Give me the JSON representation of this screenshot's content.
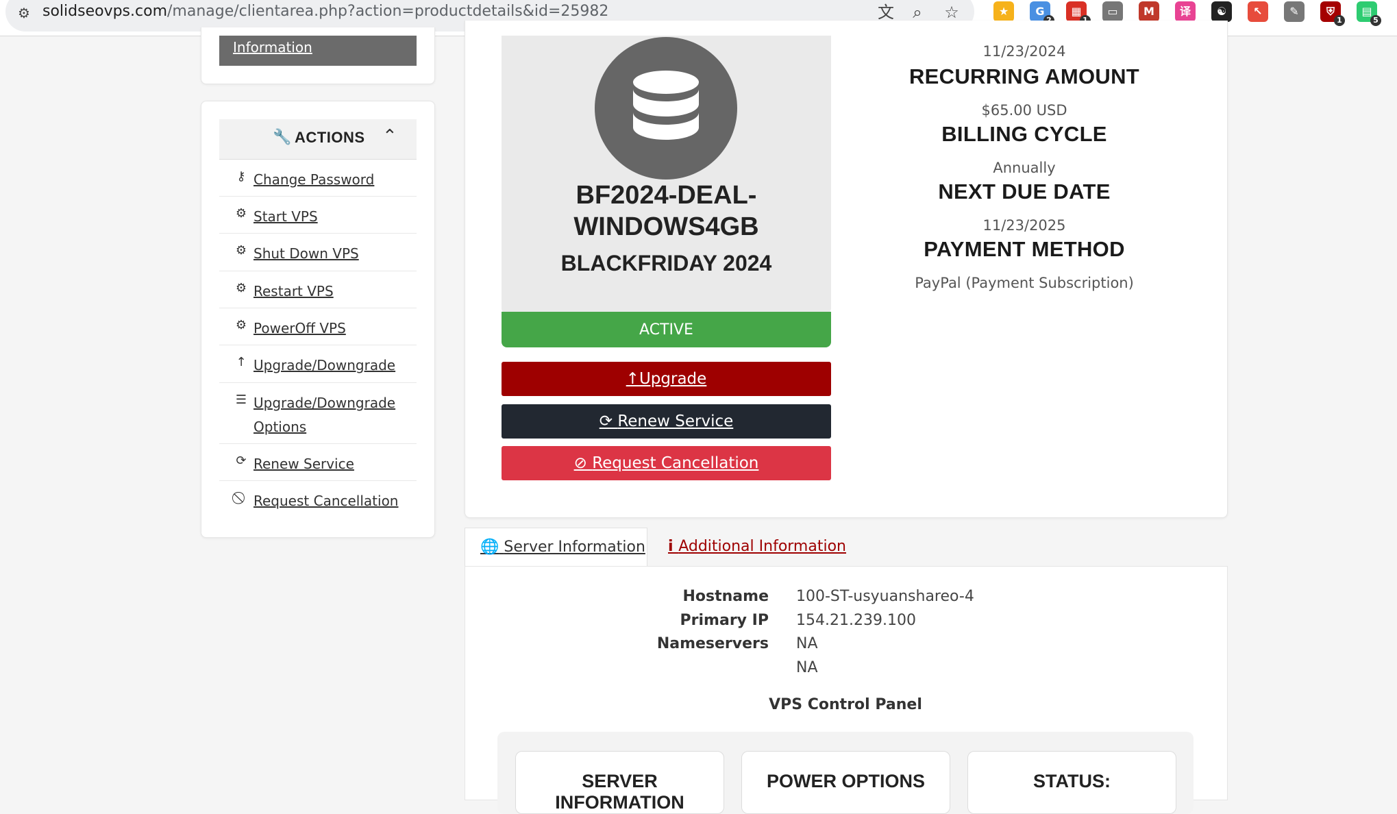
{
  "browser": {
    "url_domain": "solidseovps.com",
    "url_path": "/manage/clientarea.php?action=productdetails&id=25982",
    "extensions": [
      {
        "icon": "star-extension-icon",
        "color": "#f6b21b",
        "badge": ""
      },
      {
        "icon": "grammar-extension-icon",
        "color": "#4a90e2",
        "badge": "2"
      },
      {
        "icon": "calendar-extension-icon",
        "color": "#d93025",
        "badge": "1"
      },
      {
        "icon": "tab-extension-icon",
        "color": "#777777",
        "badge": ""
      },
      {
        "icon": "m-extension-icon",
        "color": "#c0392b",
        "badge": ""
      },
      {
        "icon": "translate-extension-icon",
        "color": "#e84393",
        "badge": ""
      },
      {
        "icon": "yin-yang-extension-icon",
        "color": "#222222",
        "badge": ""
      },
      {
        "icon": "cursor-extension-icon",
        "color": "#e74c3c",
        "badge": ""
      },
      {
        "icon": "edit-extension-icon",
        "color": "#777777",
        "badge": ""
      },
      {
        "icon": "shield-extension-icon",
        "color": "#a50000",
        "badge": "1"
      },
      {
        "icon": "puzzle-extension-icon",
        "color": "#2ecc71",
        "badge": "5"
      }
    ]
  },
  "sidebar": {
    "info_button_label": "Information",
    "actions_title": "ACTIONS",
    "actions": [
      {
        "icon": "key-icon",
        "label": "Change Password"
      },
      {
        "icon": "gears-icon",
        "label": "Start VPS"
      },
      {
        "icon": "gears-icon",
        "label": "Shut Down VPS"
      },
      {
        "icon": "gears-icon",
        "label": "Restart VPS"
      },
      {
        "icon": "gears-icon",
        "label": "PowerOff VPS"
      },
      {
        "icon": "arrow-up-icon",
        "label": "Upgrade/Downgrade"
      },
      {
        "icon": "list-icon",
        "label": "Upgrade/Downgrade Options"
      },
      {
        "icon": "refresh-icon",
        "label": "Renew Service"
      },
      {
        "icon": "ban-icon",
        "label": "Request Cancellation"
      }
    ]
  },
  "product": {
    "icon": "database-icon",
    "name_line1": "BF2024-DEAL-",
    "name_line2": "WINDOWS4GB",
    "group": "BLACKFRIDAY 2024",
    "status": "ACTIVE",
    "buttons": {
      "upgrade": "Upgrade",
      "renew": "Renew Service",
      "cancel": "Request Cancellation"
    }
  },
  "billing": {
    "registration_date": "11/23/2024",
    "recurring_label": "RECURRING AMOUNT",
    "recurring_value": "$65.00 USD",
    "cycle_label": "BILLING CYCLE",
    "cycle_value": "Annually",
    "due_label": "NEXT DUE DATE",
    "due_value": "11/23/2025",
    "payment_label": "PAYMENT METHOD",
    "payment_value": "PayPal (Payment Subscription)"
  },
  "tabs": {
    "server_info": "Server Information",
    "additional_info": "Additional Information"
  },
  "server": {
    "hostname_label": "Hostname",
    "hostname": "100-ST-usyuanshareo-4",
    "ip_label": "Primary IP",
    "ip": "154.21.239.100",
    "ns_label": "Nameservers",
    "ns1": "NA",
    "ns2": "NA",
    "control_panel_title": "VPS Control Panel",
    "cards": [
      "SERVER INFORMATION",
      "POWER OPTIONS",
      "STATUS:"
    ]
  }
}
